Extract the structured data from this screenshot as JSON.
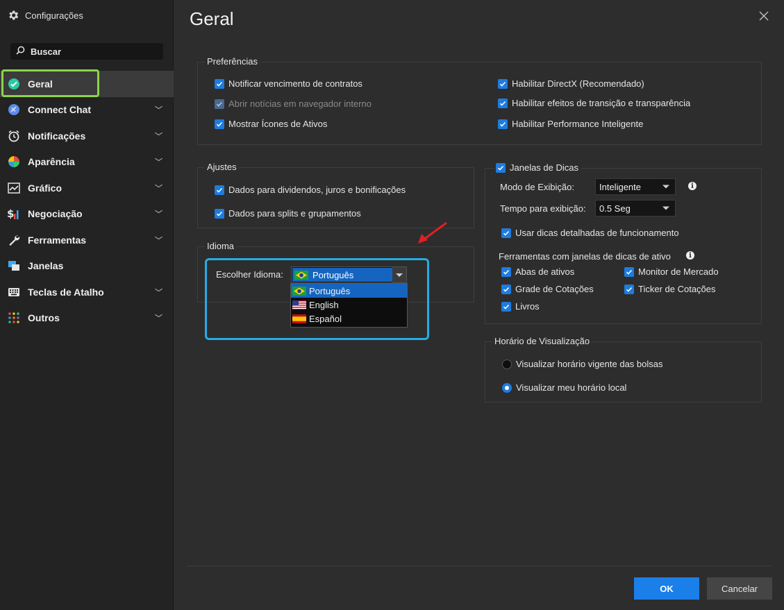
{
  "app": {
    "title": "Configurações"
  },
  "search": {
    "label": "Buscar"
  },
  "sidebar": {
    "items": [
      {
        "label": "Geral",
        "icon": "check-circle-icon",
        "active": true,
        "expandable": false
      },
      {
        "label": "Connect Chat",
        "icon": "chat-icon",
        "expandable": true
      },
      {
        "label": "Notificações",
        "icon": "alarm-clock-icon",
        "expandable": true
      },
      {
        "label": "Aparência",
        "icon": "palette-icon",
        "expandable": true
      },
      {
        "label": "Gráfico",
        "icon": "chart-icon",
        "expandable": true
      },
      {
        "label": "Negociação",
        "icon": "dollar-bars-icon",
        "expandable": true
      },
      {
        "label": "Ferramentas",
        "icon": "wrench-icon",
        "expandable": true
      },
      {
        "label": "Janelas",
        "icon": "windows-icon",
        "expandable": false
      },
      {
        "label": "Teclas de Atalho",
        "icon": "keyboard-icon",
        "expandable": true
      },
      {
        "label": "Outros",
        "icon": "dots-grid-icon",
        "expandable": true
      }
    ]
  },
  "main": {
    "title": "Geral",
    "preferencias": {
      "legend": "Preferências",
      "left": [
        {
          "label": "Notificar vencimento de contratos",
          "checked": true,
          "disabled": false
        },
        {
          "label": "Abrir notícias em navegador interno",
          "checked": true,
          "disabled": true
        },
        {
          "label": "Mostrar Ícones de Ativos",
          "checked": true,
          "disabled": false
        }
      ],
      "right": [
        {
          "label": "Habilitar DirectX (Recomendado)",
          "checked": true
        },
        {
          "label": "Habilitar efeitos de transição e transparência",
          "checked": true
        },
        {
          "label": "Habilitar Performance Inteligente",
          "checked": true
        }
      ]
    },
    "ajustes": {
      "legend": "Ajustes",
      "items": [
        {
          "label": "Dados para dividendos, juros e bonificações",
          "checked": true
        },
        {
          "label": "Dados para splits e grupamentos",
          "checked": true
        }
      ]
    },
    "idioma": {
      "legend": "Idioma",
      "label": "Escolher Idioma:",
      "selected": "Português",
      "options": [
        "Português",
        "English",
        "Español"
      ]
    },
    "dicas": {
      "legend": "Janelas de Dicas",
      "checked": true,
      "modo_label": "Modo de Exibição:",
      "modo_value": "Inteligente",
      "tempo_label": "Tempo para exibição:",
      "tempo_value": "0.5 Seg",
      "detalhadas": "Usar dicas detalhadas de funcionamento",
      "ferramentas_label": "Ferramentas com janelas de dicas de ativo",
      "ferramentas": [
        "Abas de ativos",
        "Monitor de Mercado",
        "Grade de Cotações",
        "Ticker de Cotações",
        "Livros"
      ]
    },
    "horario": {
      "legend": "Horário de Visualização",
      "options": [
        {
          "label": "Visualizar horário vigente das bolsas",
          "selected": false
        },
        {
          "label": "Visualizar meu horário local",
          "selected": true
        }
      ]
    }
  },
  "footer": {
    "ok": "OK",
    "cancel": "Cancelar"
  },
  "colors": {
    "accent": "#1a7fe8",
    "highlight_outline": "#22aee6",
    "active_outline": "#8bd44a",
    "annotation_arrow": "#e02020"
  }
}
